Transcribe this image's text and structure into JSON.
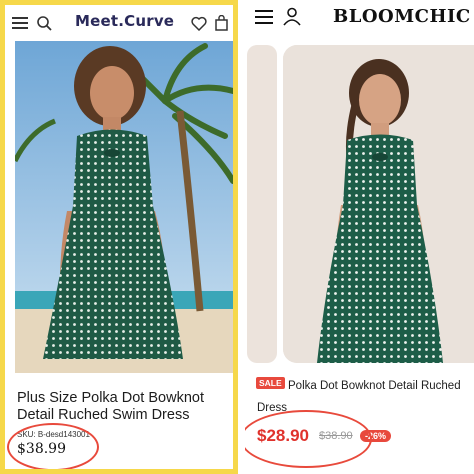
{
  "left": {
    "brand": "Meet.Curve",
    "title": "Plus Size Polka Dot Bowknot Detail Ruched Swim Dress",
    "sku": "SKU: B-desd143001",
    "price": "$38.99",
    "icons": [
      "menu-icon",
      "search-icon",
      "heart-icon",
      "bag-icon"
    ],
    "frame_color": "#f6d84a"
  },
  "right": {
    "brand": "BLOOMCHIC",
    "sale_badge": "SALE",
    "title": "Polka Dot Bowknot Detail Ruched Dress",
    "price": "$28.90",
    "original_price": "$38.90",
    "discount": "-26%",
    "icons": [
      "menu-icon",
      "user-icon"
    ],
    "accent_color": "#e0322c"
  }
}
